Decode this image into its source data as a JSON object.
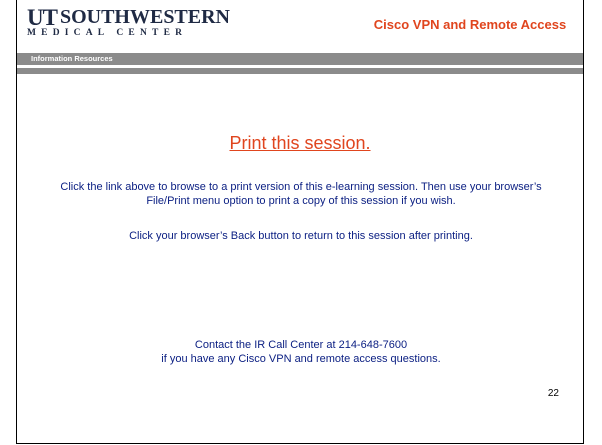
{
  "header": {
    "logo_mark": "UT",
    "logo_name": "SOUTHWESTERN",
    "logo_sub": "MEDICAL CENTER",
    "title": "Cisco VPN and Remote Access",
    "section": "Information Resources"
  },
  "main": {
    "print_link": "Print this session.",
    "instruction_1": "Click the link above to browse to a print version of this e-learning session.  Then use your browser’s File/Print menu option to print a copy of this session if you wish.",
    "instruction_2": "Click your browser’s Back button to return to this session after printing.",
    "contact_line_1": "Contact the IR Call Center at 214-648-7600",
    "contact_line_2": "if you have any Cisco VPN and remote access questions."
  },
  "footer": {
    "page_number": "22"
  },
  "colors": {
    "accent": "#e0451e",
    "body_text": "#0a1e82",
    "band": "#8b8b8b",
    "logo": "#1f2a44"
  }
}
